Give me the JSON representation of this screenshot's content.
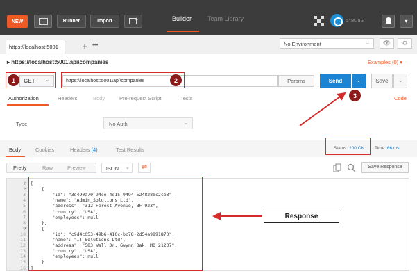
{
  "topbar": {
    "new_label": "NEW",
    "runner_label": "Runner",
    "import_label": "Import",
    "tabs": [
      {
        "label": "Builder"
      },
      {
        "label": "Team Library"
      }
    ],
    "sync_label": "SYNCING",
    "user_icon": "▾"
  },
  "request_tab": {
    "label": "https://localhost:5001",
    "add": "+",
    "more": "•••"
  },
  "environment": {
    "selected": "No Environment"
  },
  "request": {
    "title": "https://localhost:5001\\api\\companies",
    "examples": "Examples (0)",
    "method": "GET",
    "url": "https://localhost:5001\\api\\companies",
    "params_label": "Params",
    "send_label": "Send",
    "save_label": "Save",
    "subtabs": [
      "Authorization",
      "Headers",
      "Body",
      "Pre-request Script",
      "Tests"
    ],
    "code_link": "Code"
  },
  "auth": {
    "type_label": "Type",
    "selected": "No Auth"
  },
  "response": {
    "tabs": {
      "body": "Body",
      "cookies": "Cookies",
      "headers": "Headers",
      "headers_count": "(4)",
      "test_results": "Test Results"
    },
    "status_label": "Status:",
    "status_value": "200 OK",
    "time_label": "Time:",
    "time_value": "66 ms",
    "views": [
      "Pretty",
      "Raw",
      "Preview"
    ],
    "format": "JSON",
    "save_response": "Save Response",
    "line_numbers": [
      "1",
      "2",
      "3",
      "4",
      "5",
      "6",
      "7",
      "8",
      "9",
      "10",
      "11",
      "12",
      "13",
      "14",
      "15",
      "16"
    ],
    "code_lines": [
      "[",
      "    {",
      "        \"id\": \"3d490a70-94ce-4d15-9494-5248280c2ce3\",",
      "        \"name\": \"Admin_Solutions Ltd\",",
      "        \"address\": \"312 Forest Avenue, BF 923\",",
      "        \"country\": \"USA\",",
      "        \"employees\": null",
      "    },",
      "    {",
      "        \"id\": \"c9d4c053-49b6-410c-bc78-2d54a9991870\",",
      "        \"name\": \"IT_Solutions Ltd\",",
      "        \"address\": \"583 Wall Dr. Gwynn Oak, MD 21207\",",
      "        \"country\": \"USA\",",
      "        \"employees\": null",
      "    }",
      "]"
    ]
  },
  "annotations": {
    "step1": "1",
    "step2": "2",
    "step3": "3",
    "response_label": "Response",
    "color": "#d42b2b"
  },
  "colors": {
    "accent": "#ef5b25",
    "send": "#1d83d3",
    "topbar": "#3c3c3c"
  }
}
